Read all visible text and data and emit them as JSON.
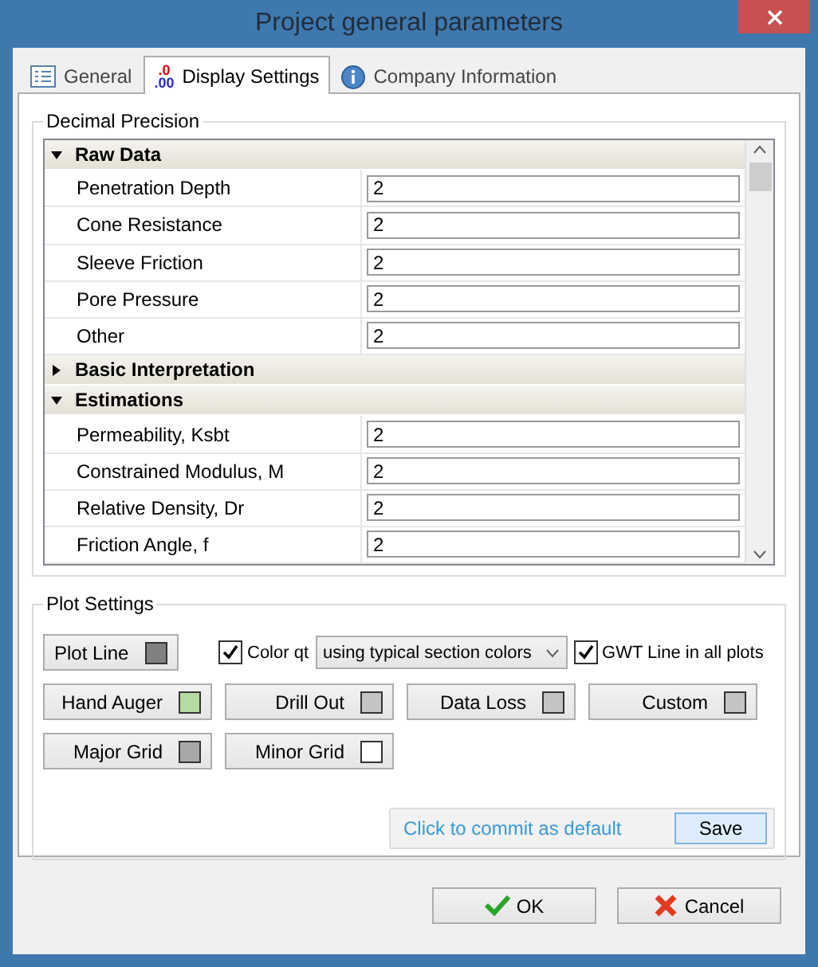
{
  "window": {
    "title": "Project general parameters"
  },
  "tabs": [
    {
      "label": "General",
      "kind": "list",
      "selected": false
    },
    {
      "label": "Display Settings",
      "kind": "decimal",
      "icon_text": [
        ".0",
        ".00"
      ],
      "selected": true
    },
    {
      "label": "Company Information",
      "kind": "info",
      "selected": false
    }
  ],
  "decimal_precision": {
    "title": "Decimal Precision",
    "sections": [
      {
        "title": "Raw Data",
        "expanded": true,
        "rows": [
          {
            "label": "Penetration Depth",
            "value": "2"
          },
          {
            "label": "Cone Resistance",
            "value": "2"
          },
          {
            "label": "Sleeve Friction",
            "value": "2"
          },
          {
            "label": "Pore Pressure",
            "value": "2"
          },
          {
            "label": "Other",
            "value": "2"
          }
        ]
      },
      {
        "title": "Basic Interpretation",
        "expanded": false
      },
      {
        "title": "Estimations",
        "expanded": true,
        "rows": [
          {
            "label": "Permeability, Ksbt",
            "value": "2"
          },
          {
            "label": "Constrained Modulus, M",
            "value": "2"
          },
          {
            "label": "Relative Density, Dr",
            "value": "2"
          },
          {
            "label": "Friction Angle, f",
            "value": "2"
          }
        ]
      }
    ]
  },
  "plot_settings": {
    "title": "Plot Settings",
    "plot_line": {
      "label": "Plot Line",
      "color": "#808080"
    },
    "color_qt": {
      "label": "Color qt",
      "checked": true
    },
    "color_mode": {
      "value": "using typical section colors"
    },
    "gwt_line": {
      "label": "GWT Line in all plots",
      "checked": true
    },
    "color_buttons": [
      {
        "label": "Hand Auger",
        "color": "#b5dba0"
      },
      {
        "label": "Drill Out",
        "color": "#c4c4c4"
      },
      {
        "label": "Data Loss",
        "color": "#c4c4c4"
      },
      {
        "label": "Custom",
        "color": "#c4c4c4"
      },
      {
        "label": "Major Grid",
        "color": "#a8a8a8"
      },
      {
        "label": "Minor Grid",
        "color": "#ffffff"
      }
    ],
    "commit_hint": "Click to commit as default",
    "save": "Save"
  },
  "buttons": [
    {
      "label": "OK",
      "kind": "ok"
    },
    {
      "label": "Cancel",
      "kind": "cancel"
    }
  ]
}
